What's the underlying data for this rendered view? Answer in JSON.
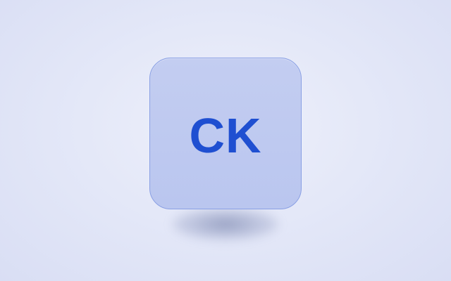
{
  "avatar": {
    "initials": "CK",
    "text_color": "#1f4fd1",
    "tile_color": "#bfcaf0",
    "border_color": "#8aa0e4"
  },
  "background": {
    "color": "#e4e8f8"
  }
}
